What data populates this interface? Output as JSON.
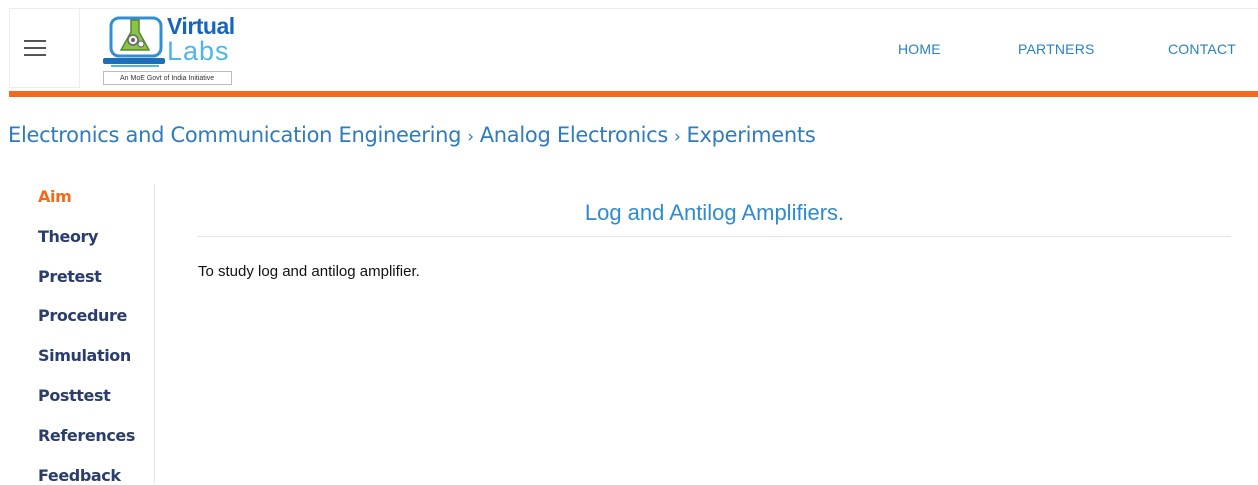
{
  "header": {
    "logo": {
      "word1": "Virtual",
      "word2": "Labs",
      "tagline": "An MoE Govt of India Initiative"
    },
    "nav": {
      "home": "HOME",
      "partners": "PARTNERS",
      "contact": "CONTACT"
    }
  },
  "breadcrumb": {
    "items": [
      "Electronics and Communication Engineering",
      "Analog Electronics",
      "Experiments"
    ],
    "separator": "›"
  },
  "sidebar": {
    "items": [
      {
        "label": "Aim",
        "active": true
      },
      {
        "label": "Theory",
        "active": false
      },
      {
        "label": "Pretest",
        "active": false
      },
      {
        "label": "Procedure",
        "active": false
      },
      {
        "label": "Simulation",
        "active": false
      },
      {
        "label": "Posttest",
        "active": false
      },
      {
        "label": "References",
        "active": false
      },
      {
        "label": "Feedback",
        "active": false
      }
    ]
  },
  "main": {
    "title": "Log and Antilog Amplifiers.",
    "aim_text": "To study log and antilog amplifier."
  },
  "colors": {
    "accent_orange": "#f26a1b",
    "link_blue": "#2b80c0",
    "sidebar_text": "#2a3d6b"
  },
  "icons": {
    "menu": "hamburger-icon",
    "logo": "virtual-labs-logo-icon"
  }
}
